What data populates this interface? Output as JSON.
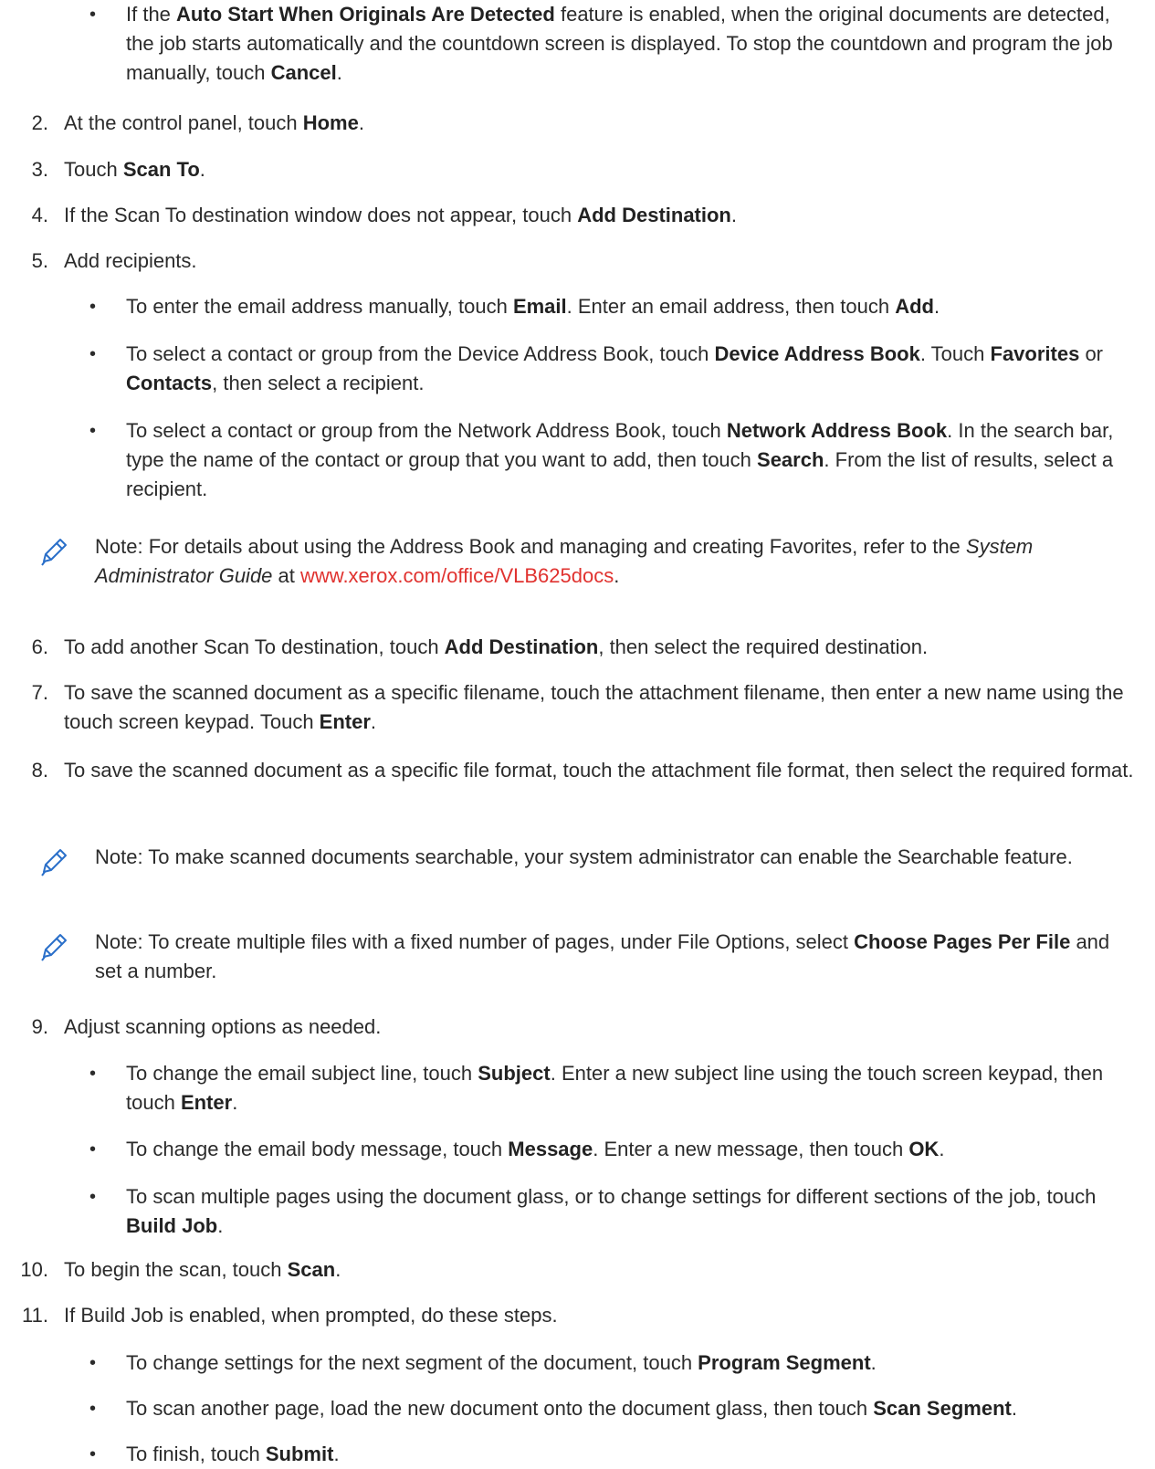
{
  "b0": [
    "If the ",
    "Auto Start When Originals Are Detected",
    " feature is enabled, when the original documents are detected, the job starts automatically and the countdown screen is displayed. To stop the countdown and program the job manually, touch ",
    "Cancel",
    "."
  ],
  "s2": {
    "num": "2.",
    "t": [
      "At the control panel, touch ",
      "Home",
      "."
    ]
  },
  "s3": {
    "num": "3.",
    "t": [
      "Touch ",
      "Scan To",
      "."
    ]
  },
  "s4": {
    "num": "4.",
    "t": [
      "If the Scan To destination window does not appear, touch ",
      "Add Destination",
      "."
    ]
  },
  "s5": {
    "num": "5.",
    "t": "Add recipients."
  },
  "s5b1": [
    "To enter the email address manually, touch ",
    "Email",
    ". Enter an email address, then touch ",
    "Add",
    "."
  ],
  "s5b2": [
    "To select a contact or group from the Device Address Book, touch ",
    "Device Address Book",
    ". Touch ",
    "Favorites",
    " or ",
    "Contacts",
    ", then select a recipient."
  ],
  "s5b3": [
    "To select a contact or group from the Network Address Book, touch ",
    "Network Address Book",
    ". In the search bar, type the name of the contact or group that you want to add, then touch ",
    "Search",
    ". From the list of results, select a recipient."
  ],
  "n1": [
    "Note: For details about using the Address Book and managing and creating Favorites, refer to the ",
    "System Administrator Guide",
    " at ",
    "www.xerox.com/office/VLB625docs",
    "."
  ],
  "s6": {
    "num": "6.",
    "t": [
      "To add another Scan To destination, touch ",
      "Add Destination",
      ", then select the required destination."
    ]
  },
  "s7": {
    "num": "7.",
    "t": [
      "To save the scanned document as a specific filename, touch the attachment filename, then enter a new name using the touch screen keypad. Touch ",
      "Enter",
      "."
    ]
  },
  "s8": {
    "num": "8.",
    "t": "To save the scanned document as a specific file format, touch the attachment file format, then select the required format."
  },
  "n2": "Note: To make scanned documents searchable, your system administrator can enable the Searchable feature.",
  "n3": [
    "Note: To create multiple files with a fixed number of pages, under File Options, select ",
    "Choose Pages Per File",
    " and set a number."
  ],
  "s9": {
    "num": "9.",
    "t": "Adjust scanning options as needed."
  },
  "s9b1": [
    "To change the email subject line, touch ",
    "Subject",
    ". Enter a new subject line using the touch screen keypad, then touch ",
    "Enter",
    "."
  ],
  "s9b2": [
    "To change the email body message, touch ",
    "Message",
    ". Enter a new message, then touch ",
    "OK",
    "."
  ],
  "s9b3": [
    "To scan multiple pages using the document glass, or to change settings for different sections of the job, touch ",
    "Build Job",
    "."
  ],
  "s10": {
    "num": "10.",
    "t": [
      "To begin the scan, touch ",
      "Scan",
      "."
    ]
  },
  "s11": {
    "num": "11.",
    "t": "If Build Job is enabled, when prompted, do these steps."
  },
  "s11b1": [
    "To change settings for the next segment of the document, touch ",
    "Program Segment",
    "."
  ],
  "s11b2": [
    "To scan another page, load the new document onto the document glass, then touch ",
    "Scan Segment",
    "."
  ],
  "s11b3": [
    "To finish, touch ",
    "Submit",
    "."
  ],
  "bullet": "•",
  "icon_color": "#2a6fc9",
  "link_color": "#e0322f"
}
